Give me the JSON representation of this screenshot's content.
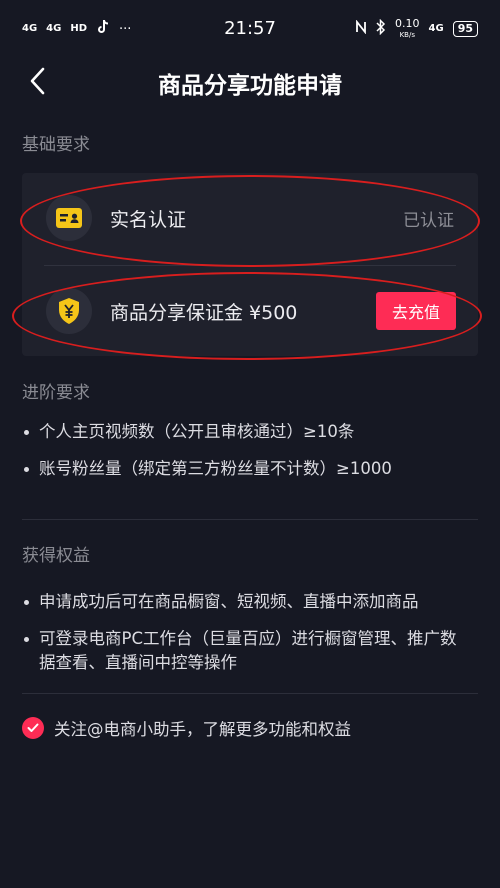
{
  "status_bar": {
    "network1": "4G",
    "network2": "4G",
    "hd": "HD",
    "more": "···",
    "time": "21:57",
    "speed_value": "0.10",
    "speed_unit": "KB/s",
    "network3": "4G",
    "battery": "95"
  },
  "nav": {
    "title": "商品分享功能申请"
  },
  "basic": {
    "section_title": "基础要求",
    "realname_label": "实名认证",
    "realname_status": "已认证",
    "deposit_label": "商品分享保证金 ¥500",
    "deposit_button": "去充值"
  },
  "advanced": {
    "section_title": "进阶要求",
    "items": [
      "个人主页视频数（公开且审核通过）≥10条",
      "账号粉丝量（绑定第三方粉丝量不计数）≥1000"
    ]
  },
  "benefits": {
    "section_title": "获得权益",
    "items": [
      "申请成功后可在商品橱窗、短视频、直播中添加商品",
      "可登录电商PC工作台（巨量百应）进行橱窗管理、推广数据查看、直播间中控等操作"
    ]
  },
  "follow": {
    "text": "关注@电商小助手，了解更多功能和权益",
    "checked": true
  },
  "colors": {
    "background": "#161823",
    "card": "#1f212c",
    "accent": "#fe2c55",
    "icon_yellow": "#f5c518",
    "annotation_red": "#d81e1e"
  }
}
